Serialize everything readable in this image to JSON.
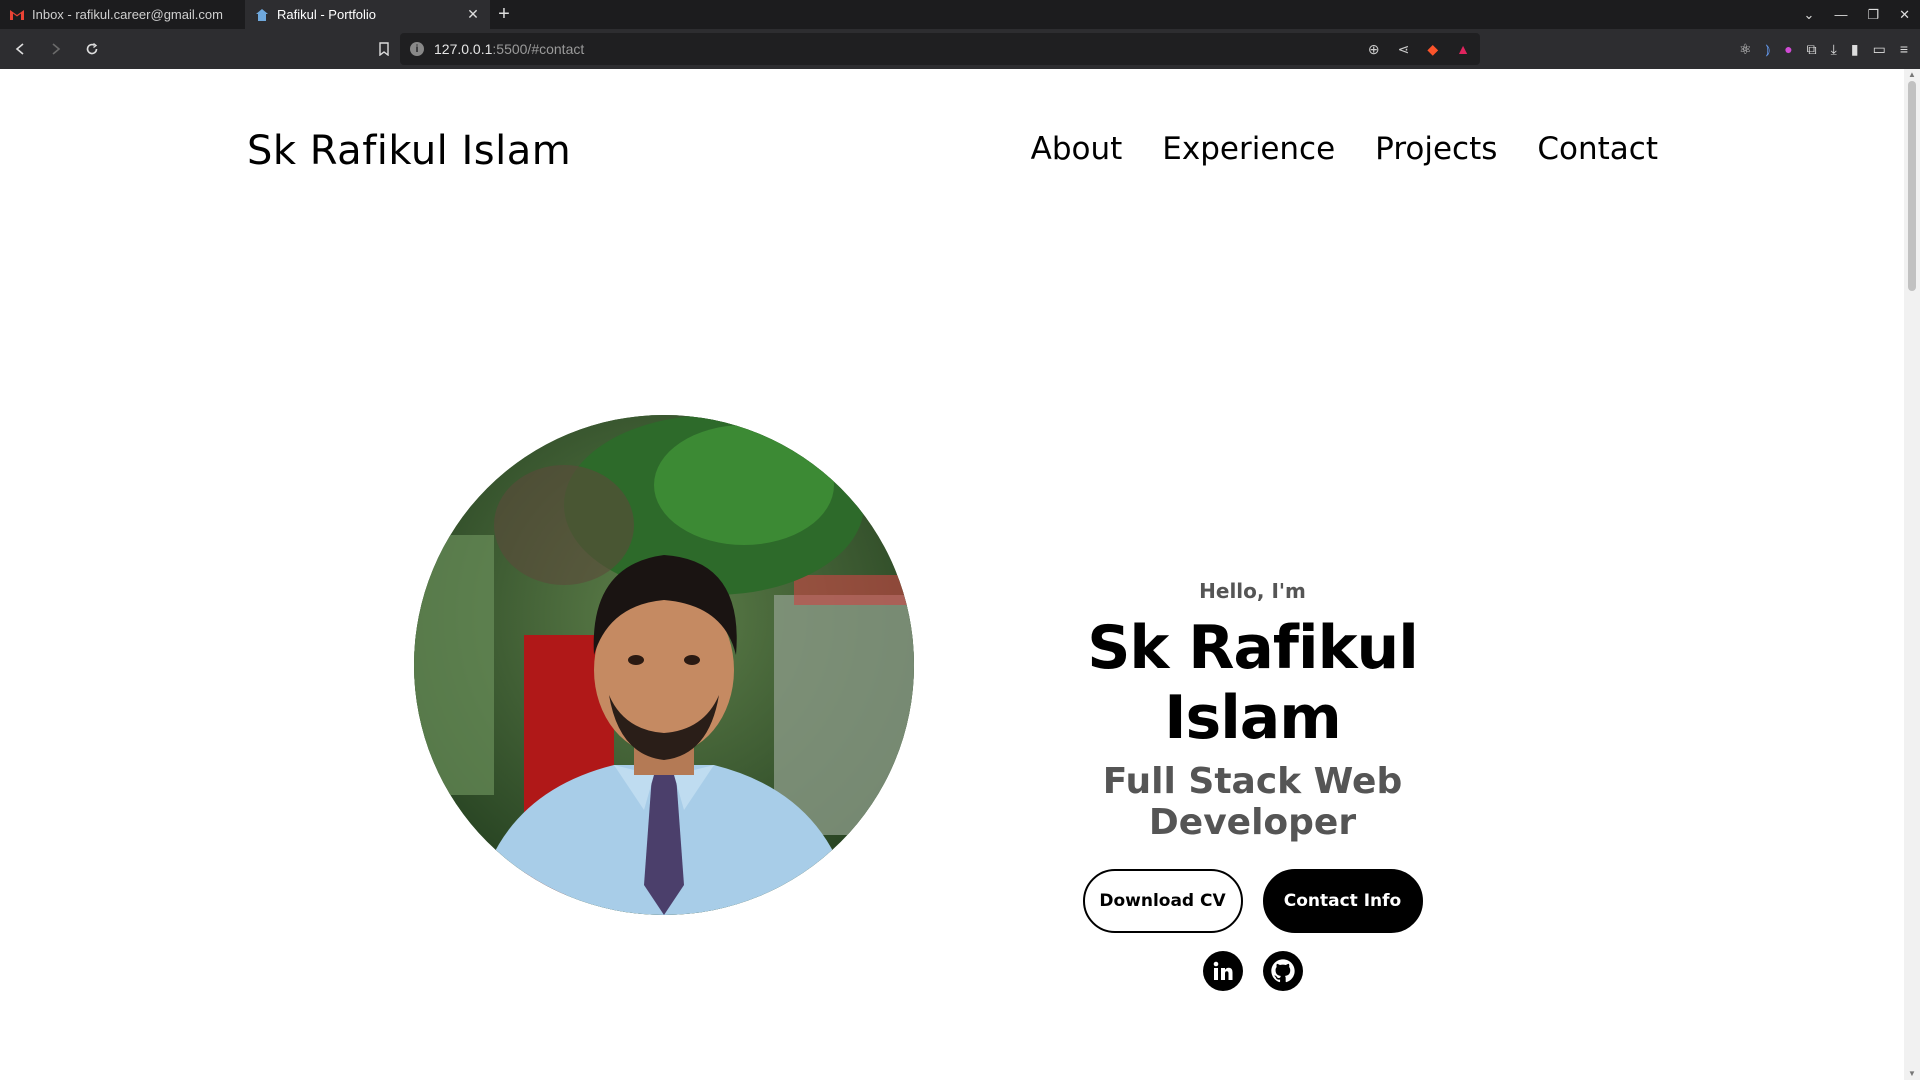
{
  "browser": {
    "tabs": [
      {
        "title": "Inbox - rafikul.career@gmail.com",
        "active": false,
        "icon": "gmail-icon"
      },
      {
        "title": "Rafikul - Portfolio",
        "active": true,
        "icon": "home-icon"
      }
    ],
    "new_tab": "+",
    "url_host": "127.0.0.1",
    "url_rest": ":5500/#contact"
  },
  "page": {
    "brand": "Sk Rafikul Islam",
    "nav": [
      "About",
      "Experience",
      "Projects",
      "Contact"
    ],
    "hero": {
      "greeting": "Hello, I'm",
      "name": "Sk Rafikul Islam",
      "role": "Full Stack Web Developer",
      "buttons": {
        "download_cv": "Download CV",
        "contact_info": "Contact Info"
      },
      "socials": [
        "linkedin-icon",
        "github-icon"
      ]
    }
  },
  "colors": {
    "chrome_bg": "#1c1c1e",
    "toolbar_bg": "#2d2d30",
    "text_primary": "#000000",
    "text_secondary": "#555555"
  }
}
